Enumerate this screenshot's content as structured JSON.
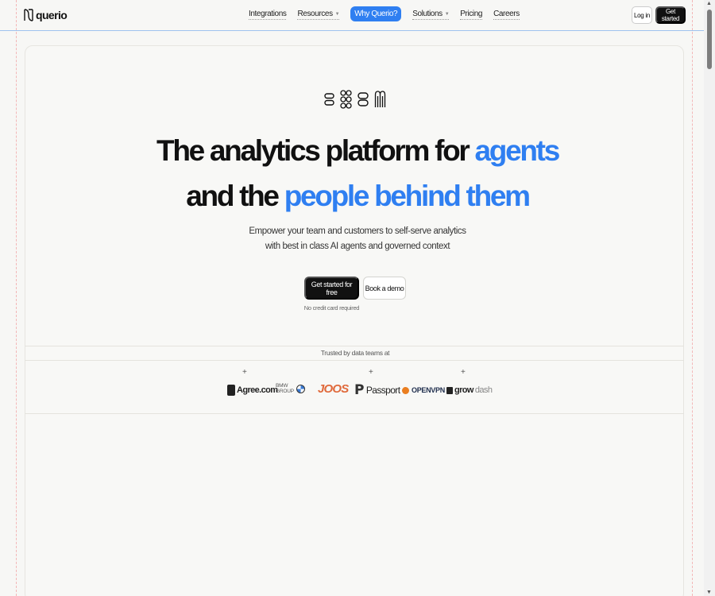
{
  "brand": {
    "logo_text": "querio",
    "accent": "#2f7ff1"
  },
  "nav": {
    "items": [
      {
        "label": "Integrations",
        "caret": false
      },
      {
        "label": "Resources",
        "caret": true
      },
      {
        "label": "Why Querio?",
        "caret": false,
        "highlighted": true
      },
      {
        "label": "Solutions",
        "caret": true
      },
      {
        "label": "Pricing",
        "caret": false
      },
      {
        "label": "Careers",
        "caret": false
      }
    ],
    "login": "Log in",
    "get_started": "Get started"
  },
  "hero": {
    "icons": [
      "pill-stack-icon",
      "circle-grid-icon",
      "capsule-stack-icon",
      "arches-icon"
    ],
    "headline_line1_prefix": "The analytics platform for ",
    "headline_line1_highlight": "agents",
    "headline_line2_prefix": "and the ",
    "headline_line2_highlight": "people behind them",
    "subtitle_line1": "Empower your team and customers to self-serve analytics",
    "subtitle_line2": "with best in class AI agents and governed context",
    "cta_primary": "Get started for free",
    "cta_secondary": "Book a demo",
    "note": "No credit card required"
  },
  "trusted": {
    "label": "Trusted by data teams at",
    "logos": {
      "agree": "Agree.com",
      "bmw_line1": "BMW",
      "bmw_line2": "GROUP",
      "joos": "JOOS",
      "passport": "Passport",
      "openvpn": "OPENVPN",
      "growdash_a": "grow",
      "growdash_b": "dash"
    }
  }
}
